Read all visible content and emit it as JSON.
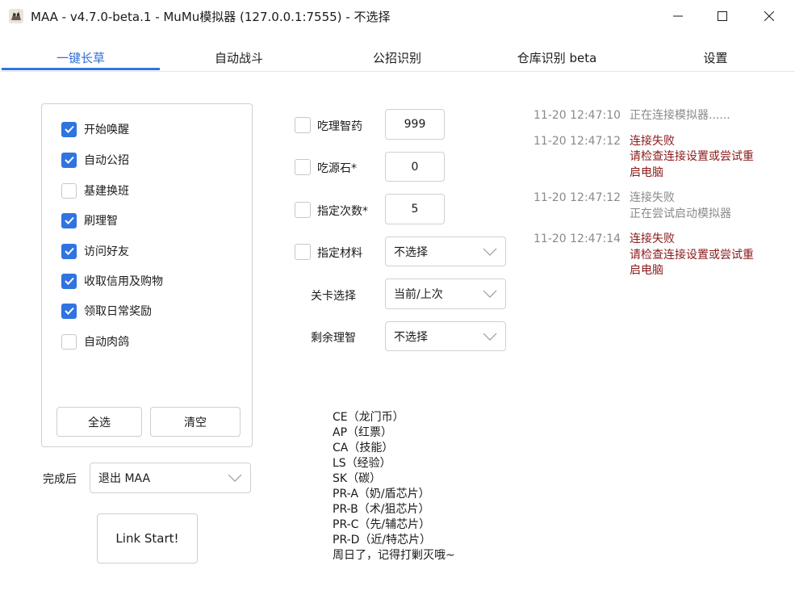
{
  "window": {
    "title": "MAA - v4.7.0-beta.1 - MuMu模拟器 (127.0.0.1:7555) - 不选择"
  },
  "tabs": [
    {
      "label": "一键长草",
      "active": true
    },
    {
      "label": "自动战斗",
      "active": false
    },
    {
      "label": "公招识别",
      "active": false
    },
    {
      "label": "仓库识别 beta",
      "active": false
    },
    {
      "label": "设置",
      "active": false
    }
  ],
  "tasks": [
    {
      "label": "开始唤醒",
      "checked": true
    },
    {
      "label": "自动公招",
      "checked": true
    },
    {
      "label": "基建换班",
      "checked": false
    },
    {
      "label": "刷理智",
      "checked": true
    },
    {
      "label": "访问好友",
      "checked": true
    },
    {
      "label": "收取信用及购物",
      "checked": true
    },
    {
      "label": "领取日常奖励",
      "checked": true
    },
    {
      "label": "自动肉鸽",
      "checked": false
    }
  ],
  "task_buttons": {
    "select_all": "全选",
    "clear": "清空"
  },
  "after_complete": {
    "label": "完成后",
    "value": "退出 MAA"
  },
  "start_button": "Link Start!",
  "fight_settings": {
    "use_medicine": {
      "label": "吃理智药",
      "checked": false,
      "value": "999"
    },
    "use_stone": {
      "label": "吃源石*",
      "checked": false,
      "value": "0"
    },
    "times": {
      "label": "指定次数*",
      "checked": false,
      "value": "5"
    },
    "material": {
      "label": "指定材料",
      "checked": false,
      "value": "不选择"
    },
    "stage": {
      "label": "关卡选择",
      "value": "当前/上次"
    },
    "remaining": {
      "label": "剩余理智",
      "value": "不选择"
    }
  },
  "stage_info": [
    "CE（龙门币）",
    "AP（红票）",
    "CA（技能）",
    "LS（经验）",
    "SK（碳）",
    "PR-A（奶/盾芯片）",
    "PR-B（术/狙芯片）",
    "PR-C（先/辅芯片）",
    "PR-D（近/特芯片）",
    "周日了，记得打剿灭哦~"
  ],
  "log": [
    {
      "time": "11-20  12:47:10",
      "message": "正在连接模拟器......",
      "color": "#8a8a8a"
    },
    {
      "time": "11-20  12:47:12",
      "message": "连接失败\n请检查连接设置或尝试重\n启电脑",
      "color": "#8b1a1a"
    },
    {
      "time": "11-20  12:47:12",
      "message": "连接失败\n正在尝试启动模拟器",
      "color": "#8a8a8a"
    },
    {
      "time": "11-20  12:47:14",
      "message": "连接失败\n请检查连接设置或尝试重\n启电脑",
      "color": "#8b1a1a"
    }
  ],
  "colors": {
    "accent": "#2f74e0",
    "error": "#8b1a1a",
    "muted": "#8a8a8a"
  }
}
